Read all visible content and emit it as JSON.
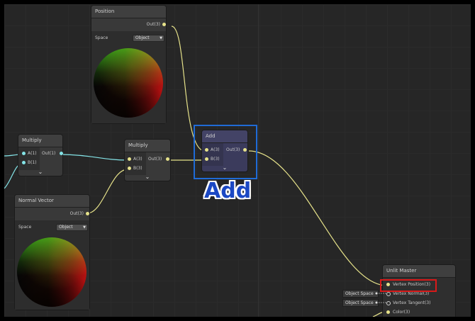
{
  "nodes": {
    "position": {
      "title": "Position",
      "out_label": "Out(3)",
      "space_label": "Space",
      "space_value": "Object"
    },
    "multiply1": {
      "title": "Multiply",
      "in_a": "A(1)",
      "in_b": "B(1)",
      "out_label": "Out(1)"
    },
    "multiply2": {
      "title": "Multiply",
      "in_a": "A(3)",
      "in_b": "B(3)",
      "out_label": "Out(3)"
    },
    "add": {
      "title": "Add",
      "in_a": "A(3)",
      "in_b": "B(3)",
      "out_label": "Out(3)"
    },
    "normal_vector": {
      "title": "Normal Vector",
      "out_label": "Out(3)",
      "space_label": "Space",
      "space_value": "Object"
    },
    "unlit_master": {
      "title": "Unlit Master",
      "ports": [
        "Vertex Position(3)",
        "Vertex Normal(3)",
        "Vertex Tangent(3)",
        "Color(3)"
      ],
      "normal_space": "Object Space",
      "tangent_space": "Object Space"
    }
  },
  "annotation": {
    "add_label": "Add"
  },
  "colors": {
    "wire_yellow": "#e6e28a",
    "wire_cyan": "#84e4e7",
    "selection_blue": "#1f6bd6",
    "highlight_red": "#d81a1a"
  },
  "icons": {
    "chevron": "chevron-down-icon",
    "caret": "dropdown-caret-icon"
  }
}
